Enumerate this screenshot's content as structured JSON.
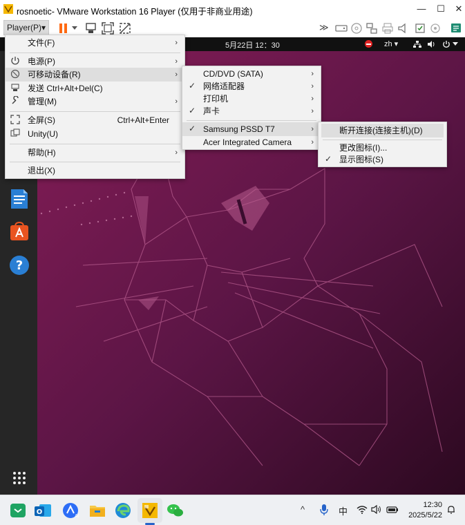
{
  "window": {
    "title": "rosnoetic- VMware Workstation 16 Player (仅用于非商业用途)",
    "minimize": "—",
    "maximize": "☐",
    "close": "✕"
  },
  "toolbar": {
    "player_label": "Player(P)",
    "player_arrow": "▾"
  },
  "ubuntu_topbar": {
    "datetime": "5月22日  12：30",
    "lang": "zh ▾"
  },
  "player_menu": [
    {
      "label": "文件(F)",
      "arrow": "›"
    },
    {
      "label": "电源(P)",
      "arrow": "›"
    },
    {
      "label": "可移动设备(R)",
      "arrow": "›"
    },
    {
      "label": "发送 Ctrl+Alt+Del(C)"
    },
    {
      "label": "管理(M)",
      "arrow": "›"
    },
    {
      "label": "全屏(S)",
      "shortcut": "Ctrl+Alt+Enter"
    },
    {
      "label": "Unity(U)"
    },
    {
      "label": "帮助(H)",
      "arrow": "›"
    },
    {
      "label": "退出(X)"
    }
  ],
  "devices_menu": [
    {
      "label": "CD/DVD (SATA)",
      "arrow": "›"
    },
    {
      "label": "网络适配器",
      "arrow": "›",
      "check": "✓"
    },
    {
      "label": "打印机",
      "arrow": "›"
    },
    {
      "label": "声卡",
      "arrow": "›",
      "check": "✓"
    },
    {
      "label": "Samsung PSSD T7",
      "arrow": "›",
      "check": "✓"
    },
    {
      "label": "Acer Integrated Camera",
      "arrow": "›"
    }
  ],
  "ssd_menu": [
    {
      "label": "断开连接(连接主机)(D)"
    },
    {
      "label": "更改图标(I)..."
    },
    {
      "label": "显示图标(S)",
      "check": "✓"
    }
  ],
  "taskbar": {
    "time": "12:30",
    "date": "2025/5/22",
    "ime": "中",
    "tray_chevron": "^"
  },
  "colors": {
    "accent_orange": "#e95420",
    "pause_orange": "#ff6a13",
    "menu_bg": "#f2f2f2",
    "vm_bg": "#3a0d2e"
  }
}
